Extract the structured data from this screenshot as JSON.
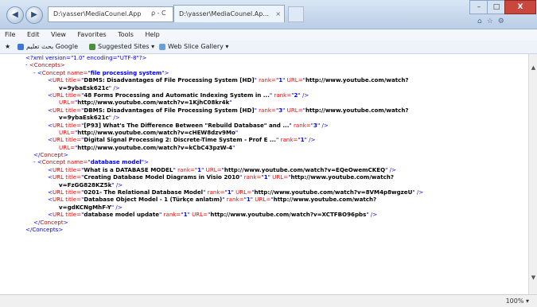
{
  "browser": {
    "address": "D:\\yasser\\MediaCounel.App",
    "address_controls": "ρ - C",
    "tab_title": "D:\\yasser\\MediaCounel.Ap...",
    "tab_close": "×"
  },
  "menu": [
    "File",
    "Edit",
    "View",
    "Favorites",
    "Tools",
    "Help"
  ],
  "favorites": [
    {
      "label": "بحث تعليم Google",
      "icon_color": "#3c78d8"
    },
    {
      "label": "Suggested Sites ▾",
      "icon_color": "#4a8f3c"
    },
    {
      "label": "Web Slice Gallery ▾",
      "icon_color": "#6aa0d8"
    }
  ],
  "window_buttons": {
    "minimize": "–",
    "maximize": "□",
    "close": "X"
  },
  "status": {
    "zoom": "100% ▾"
  },
  "xml": {
    "declaration": "<?xml version=\"1.0\" encoding=\"UTF-8\"?>",
    "root_open": "<Concepts>",
    "root_close": "</Concepts>",
    "concepts": [
      {
        "name": "file processing system",
        "urls": [
          {
            "title": "DBMS: Disadvantages of File Processing System [HD]",
            "rank": "1",
            "url": "http://www.youtube.com/watch?v=9ybaEsk621c"
          },
          {
            "title": "48 Forms Processing and Automatic Indexing System in ...",
            "rank": "2",
            "url": "http://www.youtube.com/watch?v=1KjhC08kr4k"
          },
          {
            "title": "DBMS: Disadvantages of File Processing System [HD]",
            "rank": "3",
            "url": "http://www.youtube.com/watch?v=9ybaEsk621c"
          },
          {
            "title": "[P93] What's The Difference Between \"Rebuild Database\" and ...",
            "rank": "3",
            "url": "http://www.youtube.com/watch?v=cHEW8dzv9Mo"
          },
          {
            "title": "Digital Signal Processing 2: Discrete-Time System - Prof E ...",
            "rank": "1",
            "url": "http://www.youtube.com/watch?v=kCbC43pzW-4"
          }
        ]
      },
      {
        "name": "database model",
        "urls": [
          {
            "title": "What is a DATABASE MODEL",
            "rank": "1",
            "url": "http://www.youtube.com/watch?v=EQeOwemCKEQ"
          },
          {
            "title": "Creating Database Model Diagrams in Visio 2010",
            "rank": "1",
            "url": "http://www.youtube.com/watch?v=FzGG828KZ5k"
          },
          {
            "title": "0201- The Relational Database Model",
            "rank": "1",
            "url": "http://www.youtube.com/watch?v=8VM4p8wgzeU"
          },
          {
            "title": "Database Object Model - 1 (Türkçe anlatım)",
            "rank": "1",
            "url": "http://www.youtube.com/watch?v=gdKCNgMhF-Y"
          },
          {
            "title": "database model update",
            "rank": "1",
            "url": "http://www.youtube.com/watch?v=XCTFBO96pbs"
          }
        ]
      }
    ]
  }
}
